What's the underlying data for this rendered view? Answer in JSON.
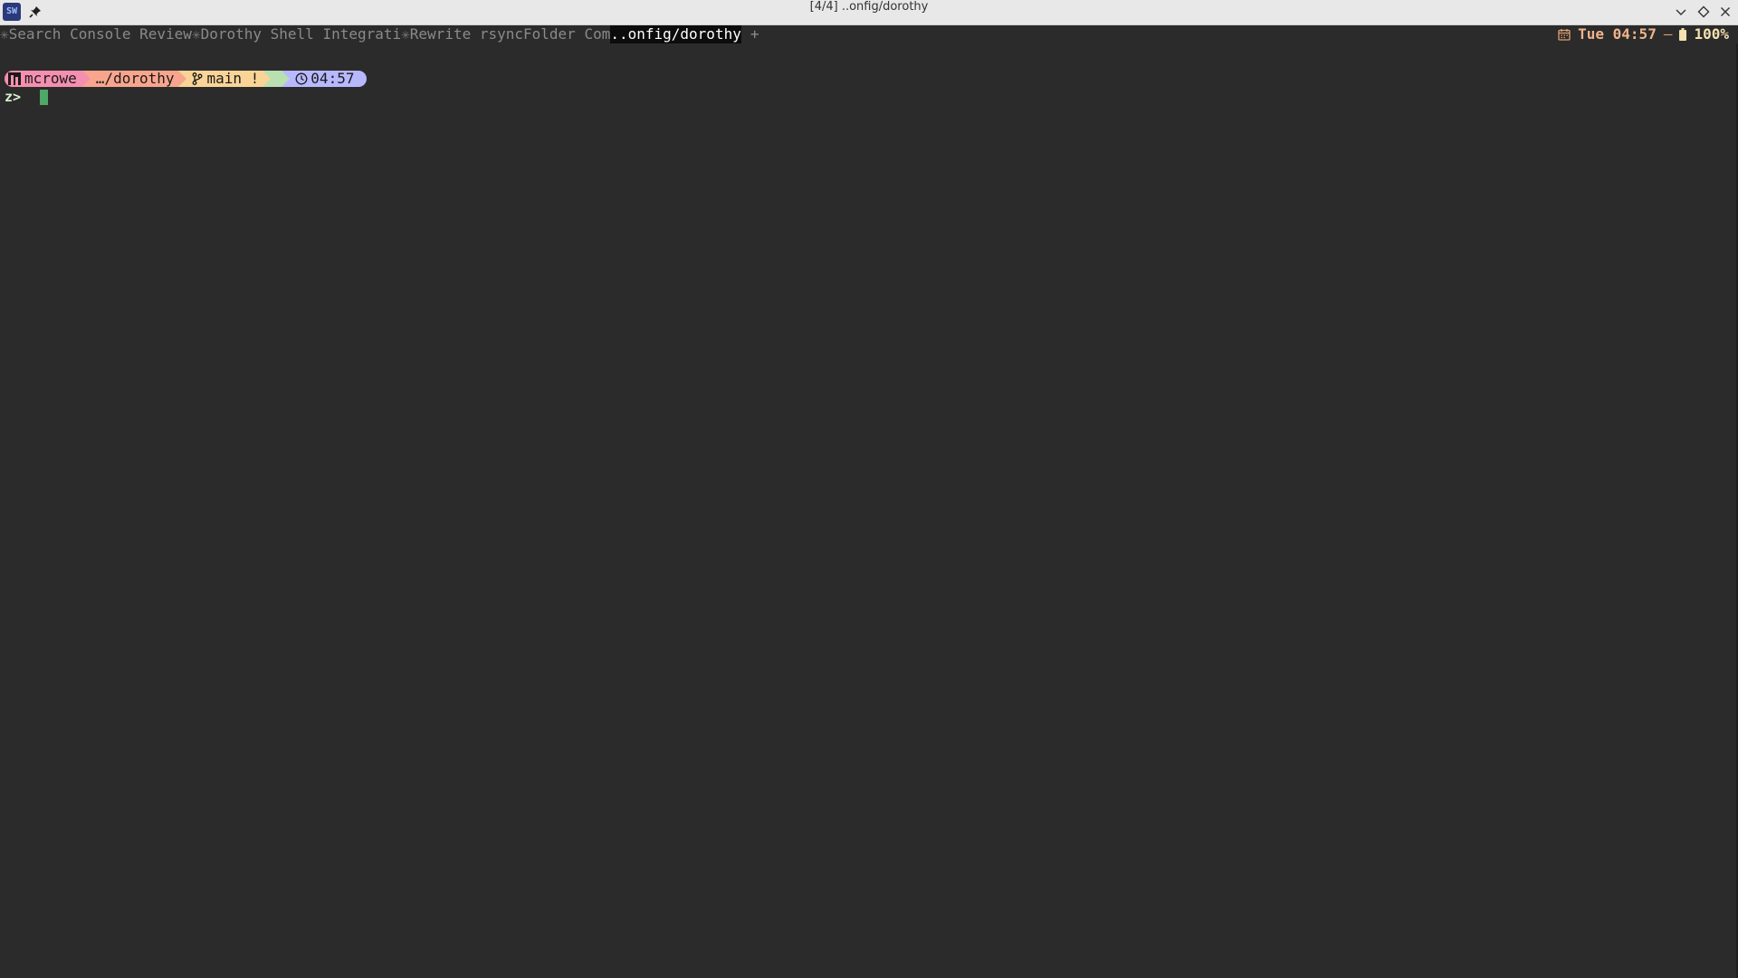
{
  "window": {
    "title": "[4/4] ..onfig/dorothy",
    "app_icon_text": "SW",
    "icons": [
      "pin-icon",
      "minimize-icon",
      "maximize-icon",
      "close-icon"
    ]
  },
  "tabs": [
    {
      "mark": "✳",
      "label": " Search Console Review"
    },
    {
      "mark": "✳",
      "label": " Dorothy Shell Integrati"
    },
    {
      "mark": "✳",
      "label": " Rewrite rsyncFolder Com"
    },
    {
      "mark": "",
      "label": "..onfig/dorothy",
      "active": true
    }
  ],
  "new_tab_label": "+",
  "status": {
    "calendar_icon": "calendar-icon",
    "datetime": "Tue 04:57",
    "separator": "—",
    "battery_icon": "battery-icon",
    "battery": "100%"
  },
  "prompt": {
    "user": "mcrowe",
    "dir": "…/dorothy",
    "git": "main !",
    "time": "04:57",
    "input_prefix": "z>",
    "colors": {
      "user": "#f58fb0",
      "dir": "#f9a58e",
      "git": "#f9d496",
      "gap": "#b8e0b0",
      "time": "#b8b8ff",
      "cursor": "#4fa866"
    }
  }
}
